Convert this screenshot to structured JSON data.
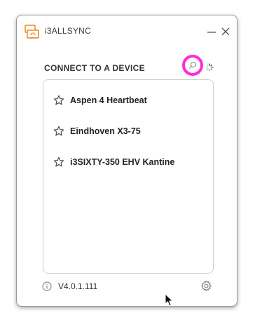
{
  "app": {
    "title": "i3ALLSYNC"
  },
  "section": {
    "title": "CONNECT TO A DEVICE"
  },
  "devices": [
    {
      "name": "Aspen 4 Heartbeat"
    },
    {
      "name": "Eindhoven X3-75"
    },
    {
      "name": "i3SIXTY-350 EHV Kantine"
    }
  ],
  "footer": {
    "version": "V4.0.1.111"
  },
  "colors": {
    "accent_logo": "#f08a24",
    "highlight_ring": "#ff2bd6",
    "text": "#222222",
    "border": "#cfcfcf"
  },
  "icons": {
    "logo": "sync-logo-icon",
    "minimize": "minimize-icon",
    "close": "close-icon",
    "search": "search-icon",
    "loading": "loading-spinner-icon",
    "favorite": "star-outline-icon",
    "info": "info-icon",
    "settings": "gear-icon"
  }
}
